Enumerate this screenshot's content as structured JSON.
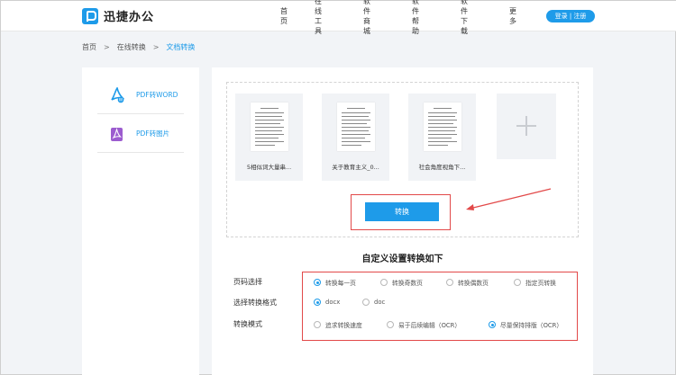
{
  "header": {
    "logo_text": "迅捷办公",
    "nav": [
      "首页",
      "在线工具",
      "软件商城",
      "软件帮助",
      "软件下载",
      "更多"
    ],
    "login_label": "登录 | 注册"
  },
  "breadcrumb": [
    "首页",
    "在线转换",
    "文档转换"
  ],
  "sidebar": {
    "items": [
      {
        "label": "PDF转WORD",
        "icon": "pdf-to-word-icon"
      },
      {
        "label": "PDF转图片",
        "icon": "pdf-to-image-icon"
      }
    ]
  },
  "files": [
    {
      "name": "5相似词大量串..."
    },
    {
      "name": "关于教育主义_0..."
    },
    {
      "name": "社会角度视角下..."
    }
  ],
  "convert_label": "转换",
  "settings": {
    "title": "自定义设置转换如下",
    "page_label": "页码选择",
    "page_options": [
      "转换每一页",
      "转换奇数页",
      "转换偶数页",
      "指定页转换"
    ],
    "page_selected": 0,
    "format_label": "选择转换格式",
    "format_options": [
      "docx",
      "doc"
    ],
    "format_selected": 0,
    "mode_label": "转换模式",
    "mode_options": [
      "追求转换速度",
      "易于后续编辑（OCR）",
      "尽量保持排版（OCR）"
    ],
    "mode_selected": 2
  },
  "colors": {
    "accent": "#1e9be9",
    "highlight": "#e24949"
  }
}
